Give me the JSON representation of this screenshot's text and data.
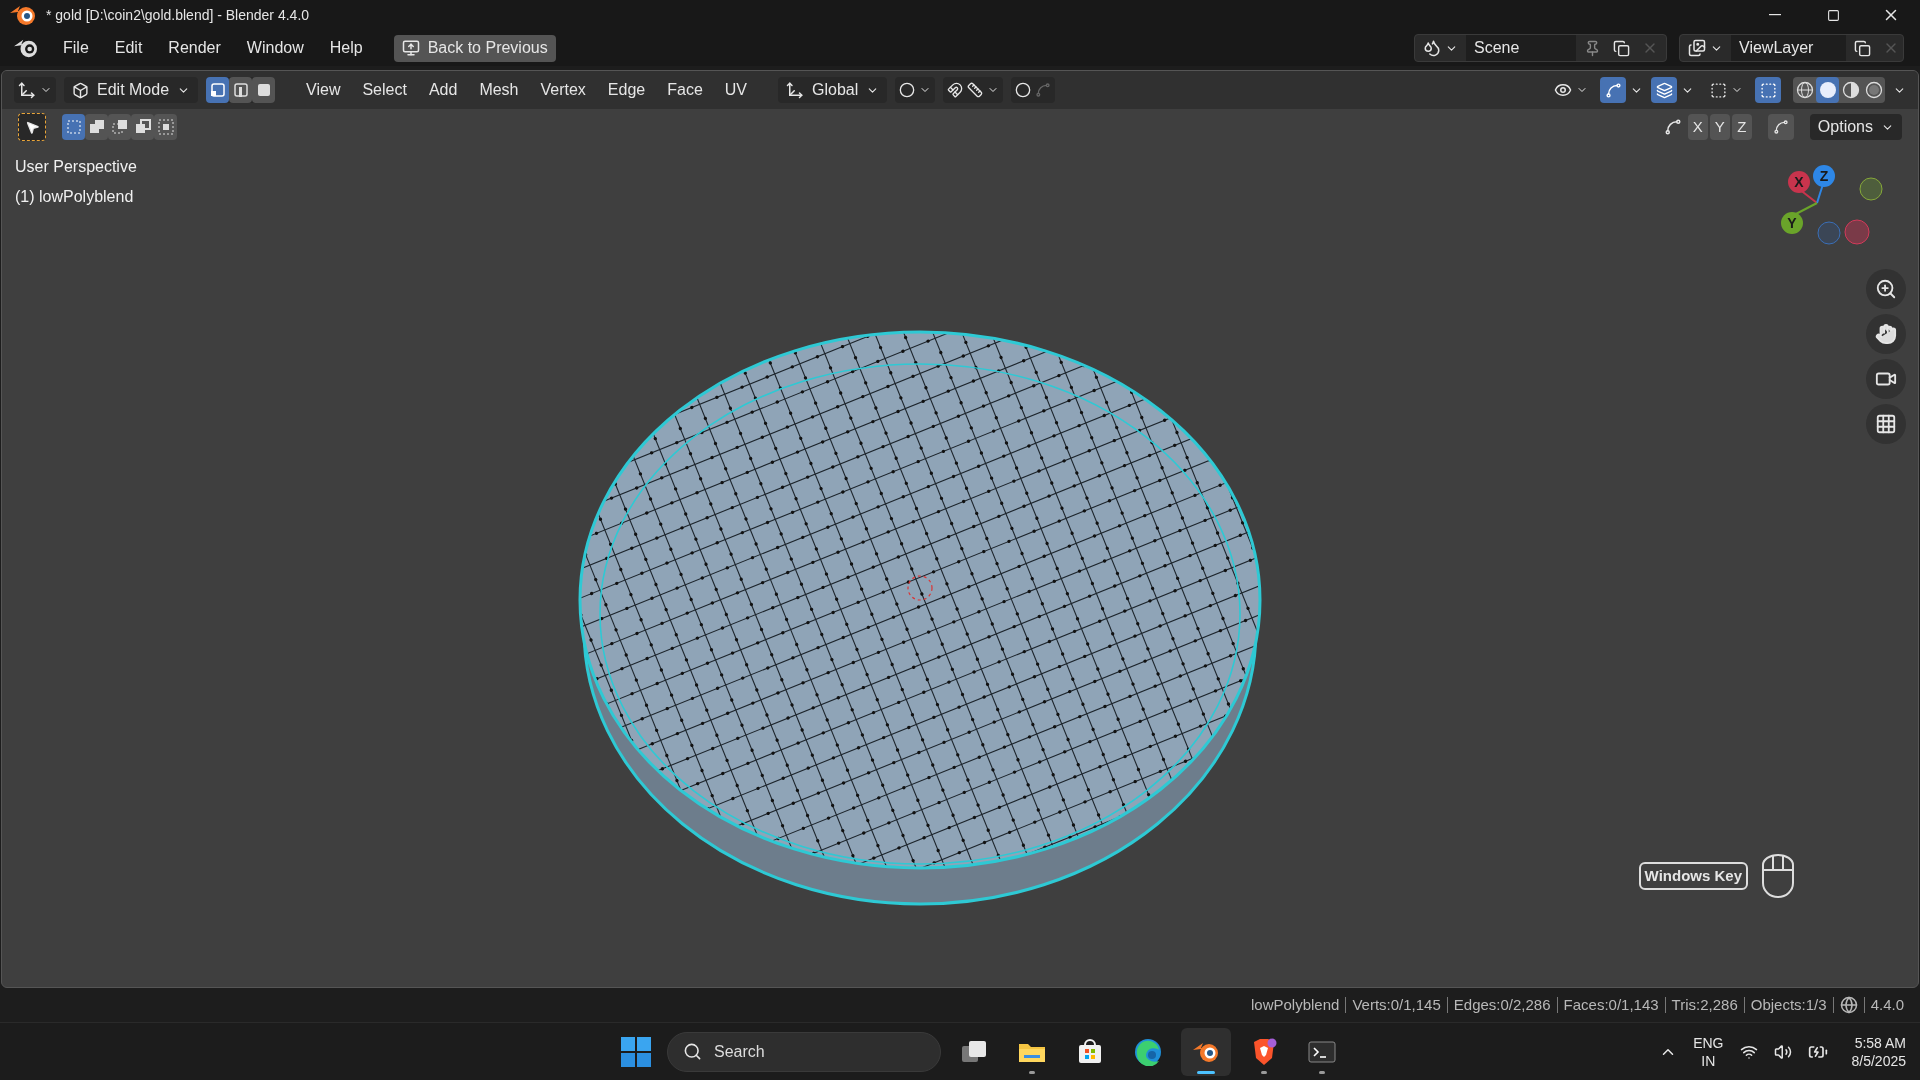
{
  "window": {
    "title": "* gold [D:\\coin2\\gold.blend] - Blender 4.4.0"
  },
  "menu": [
    "File",
    "Edit",
    "Render",
    "Window",
    "Help"
  ],
  "back_button": "Back to Previous",
  "scene": {
    "name": "Scene"
  },
  "view_layer": {
    "name": "ViewLayer"
  },
  "header": {
    "mode": "Edit Mode",
    "select_modes": [
      {
        "kind": "vertex",
        "selected": true
      },
      {
        "kind": "edge",
        "selected": false
      },
      {
        "kind": "face",
        "selected": false
      }
    ],
    "menus": [
      "View",
      "Select",
      "Add",
      "Mesh",
      "Vertex",
      "Edge",
      "Face",
      "UV"
    ],
    "orientation": "Global",
    "toggles": [
      {
        "kind": "gizmo",
        "on": true
      },
      {
        "kind": "overlay",
        "on": true
      },
      {
        "kind": "xray",
        "on": true
      }
    ],
    "shading": [
      {
        "kind": "wireframe",
        "selected": false
      },
      {
        "kind": "solid",
        "selected": true
      },
      {
        "kind": "material",
        "selected": false
      },
      {
        "kind": "rendered",
        "selected": false
      }
    ]
  },
  "tool_settings": {
    "box_modes": [
      {
        "kind": "new",
        "selected": true
      },
      {
        "kind": "extend",
        "selected": false
      },
      {
        "kind": "subtract",
        "selected": false
      },
      {
        "kind": "invert",
        "selected": false
      },
      {
        "kind": "intersect",
        "selected": false
      }
    ],
    "axes": [
      "X",
      "Y",
      "Z"
    ],
    "options": "Options"
  },
  "viewport": {
    "view_name": "User Perspective",
    "object": "(1) lowPolyblend",
    "gizmo": [
      "X",
      "Y",
      "Z"
    ],
    "key_hint": "Windows Key"
  },
  "status_bar": {
    "items": [
      "lowPolyblend",
      "Verts:0/1,145",
      "Edges:0/2,286",
      "Faces:0/1,143",
      "Tris:2,286",
      "Objects:1/3"
    ],
    "version": "4.4.0"
  },
  "taskbar": {
    "search": {
      "placeholder": "Search"
    },
    "apps": [
      {
        "kind": "task-view",
        "running": false,
        "active": false
      },
      {
        "kind": "folder",
        "running": true,
        "active": false
      },
      {
        "kind": "store",
        "running": false,
        "active": false
      },
      {
        "kind": "browser",
        "running": false,
        "active": false
      },
      {
        "kind": "blender",
        "running": true,
        "active": true
      },
      {
        "kind": "lion",
        "running": true,
        "active": false
      },
      {
        "kind": "terminal",
        "running": true,
        "active": false
      }
    ],
    "language": "ENG",
    "region": "IN",
    "time": "5:58 AM",
    "date": "8/5/2025"
  }
}
